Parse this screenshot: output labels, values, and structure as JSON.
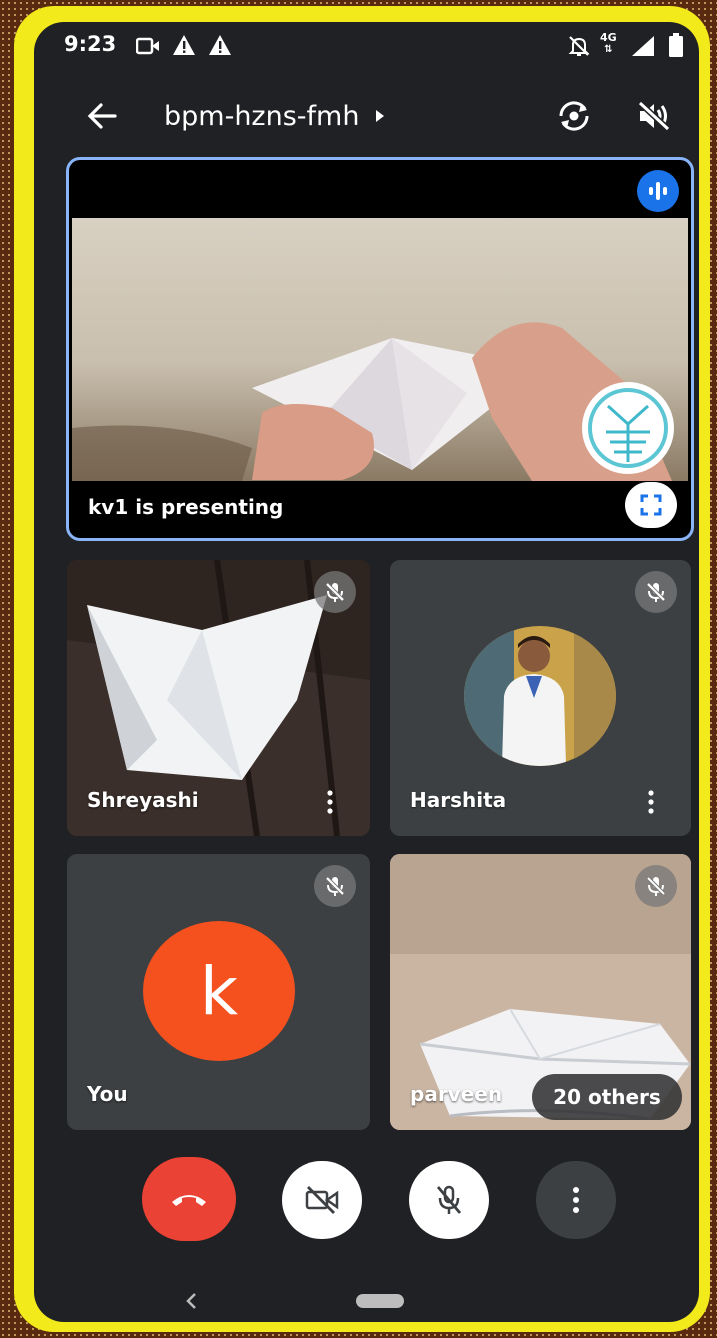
{
  "status": {
    "time": "9:23",
    "network": "4G"
  },
  "header": {
    "meeting_code": "bpm-hzns-fmh"
  },
  "presentation": {
    "caption": "kv1 is presenting"
  },
  "participants": [
    {
      "name": "Shreyashi",
      "muted": true
    },
    {
      "name": "Harshita",
      "muted": true
    },
    {
      "name": "You",
      "avatar_letter": "k",
      "muted": true
    },
    {
      "name": "parveen",
      "muted": true
    }
  ],
  "others": {
    "label": "20 others"
  },
  "colors": {
    "accent": "#8ab4f8",
    "end_call": "#ea4335",
    "avatar": "#f4511e",
    "frame": "#f2ea1a"
  },
  "icons": [
    "back-arrow-icon",
    "switch-camera-icon",
    "speaker-off-icon",
    "audio-level-icon",
    "fullscreen-icon",
    "mic-off-icon",
    "more-vert-icon",
    "call-end-icon",
    "camera-off-icon"
  ]
}
